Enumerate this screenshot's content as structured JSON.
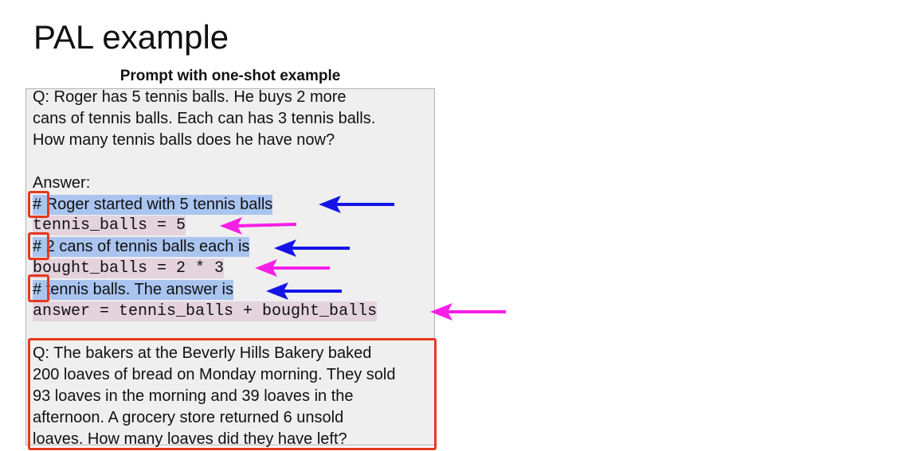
{
  "slide": {
    "title": "PAL example",
    "subtitle": "Prompt with one-shot example"
  },
  "prompt": {
    "question_lines": [
      "Q: Roger has 5 tennis balls. He buys 2 more",
      "cans of tennis balls. Each can has 3 tennis balls.",
      "How many tennis balls does he have now?"
    ],
    "answer_label": "Answer:",
    "code_lines": [
      {
        "hash": "#",
        "text": " Roger started with 5 tennis balls"
      },
      {
        "text": "tennis_balls = 5"
      },
      {
        "hash": "#",
        "text": " 2 cans of tennis balls each is"
      },
      {
        "text": "bought_balls = 2 * 3"
      },
      {
        "hash": "#",
        "text": " tennis balls. The answer is"
      },
      {
        "text": "answer = tennis_balls + bought_balls"
      }
    ],
    "new_question_lines": [
      "Q: The bakers at the Beverly Hills Bakery baked",
      "200 loaves of bread on Monday morning. They sold",
      "93 loaves in the morning and 39 loaves in the",
      "afternoon. A grocery store returned 6 unsold",
      "loaves. How many loaves did they have left?"
    ]
  },
  "colors": {
    "comment_highlight": "#a9c4ef",
    "code_highlight": "#e4d3dd",
    "comment_arrow": "#1414e6",
    "code_arrow": "#f51fe6",
    "box_outline": "#e53a1e"
  }
}
